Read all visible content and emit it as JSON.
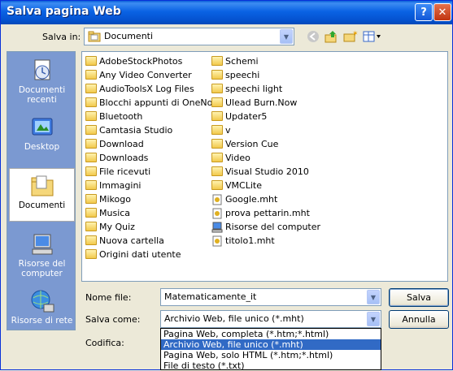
{
  "window": {
    "title": "Salva pagina Web"
  },
  "toolbar": {
    "save_in_label": "Salva in:",
    "location": "Documenti",
    "icons": [
      "back-icon",
      "up-folder-icon",
      "new-folder-icon",
      "view-menu-icon"
    ]
  },
  "places": [
    {
      "label": "Documenti recenti",
      "icon": "recent-documents-icon"
    },
    {
      "label": "Desktop",
      "icon": "desktop-icon"
    },
    {
      "label": "Documenti",
      "icon": "my-documents-icon"
    },
    {
      "label": "Risorse del computer",
      "icon": "my-computer-icon"
    },
    {
      "label": "Risorse di rete",
      "icon": "network-icon"
    }
  ],
  "files_col1": [
    {
      "name": "AdobeStockPhotos",
      "type": "folder"
    },
    {
      "name": "Any Video Converter",
      "type": "folder"
    },
    {
      "name": "AudioToolsX Log Files",
      "type": "folder"
    },
    {
      "name": "Blocchi appunti di OneNote",
      "type": "folder"
    },
    {
      "name": "Bluetooth",
      "type": "folder"
    },
    {
      "name": "Camtasia Studio",
      "type": "folder"
    },
    {
      "name": "Download",
      "type": "folder"
    },
    {
      "name": "Downloads",
      "type": "folder"
    },
    {
      "name": "File ricevuti",
      "type": "folder"
    },
    {
      "name": "Immagini",
      "type": "folder"
    },
    {
      "name": "Mikogo",
      "type": "folder"
    },
    {
      "name": "Musica",
      "type": "folder"
    },
    {
      "name": "My Quiz",
      "type": "folder"
    },
    {
      "name": "Nuova cartella",
      "type": "folder"
    },
    {
      "name": "Origini dati utente",
      "type": "folder"
    }
  ],
  "files_col2": [
    {
      "name": "Schemi",
      "type": "folder"
    },
    {
      "name": "speechi",
      "type": "folder"
    },
    {
      "name": "speechi light",
      "type": "folder"
    },
    {
      "name": "Ulead Burn.Now",
      "type": "folder"
    },
    {
      "name": "Updater5",
      "type": "folder"
    },
    {
      "name": "v",
      "type": "folder"
    },
    {
      "name": "Version Cue",
      "type": "folder"
    },
    {
      "name": "Video",
      "type": "folder"
    },
    {
      "name": "Visual Studio 2010",
      "type": "folder"
    },
    {
      "name": "VMCLite",
      "type": "folder"
    },
    {
      "name": "Google.mht",
      "type": "mht"
    },
    {
      "name": "prova pettarin.mht",
      "type": "mht"
    },
    {
      "name": "Risorse del computer",
      "type": "shortcut"
    },
    {
      "name": "titolo1.mht",
      "type": "mht"
    }
  ],
  "form": {
    "filename_label": "Nome file:",
    "filename_value": "Matematicamente_it",
    "savetype_label": "Salva come:",
    "savetype_value": "Archivio Web, file unico (*.mht)",
    "encoding_label": "Codifica:",
    "save_button": "Salva",
    "cancel_button": "Annulla"
  },
  "savetype_options": [
    "Pagina Web, completa (*.htm;*.html)",
    "Archivio Web, file unico (*.mht)",
    "Pagina Web, solo HTML (*.htm;*.html)",
    "File di testo (*.txt)"
  ],
  "colors": {
    "title_bar": "#0a5fd8",
    "selection": "#316ac5",
    "places_bar": "#7b99d1"
  }
}
